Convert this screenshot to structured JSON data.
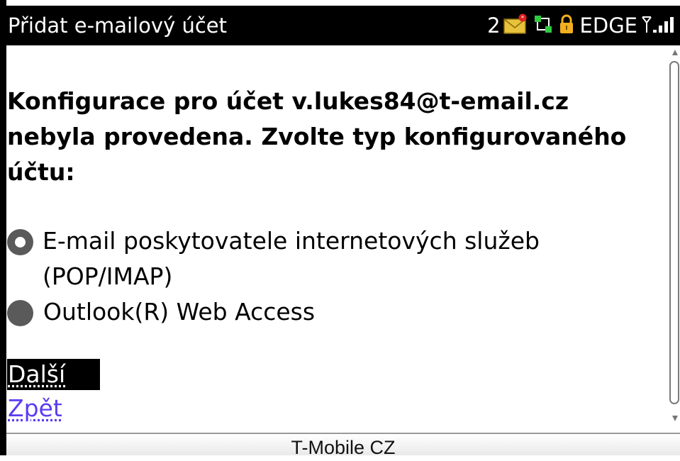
{
  "window": {
    "title": "Přidat e-mailový účet"
  },
  "status_bar": {
    "message_count": "2",
    "network": "EDGE",
    "icons": [
      "new-mail-icon",
      "data-transfer-icon",
      "lock-icon",
      "antenna-icon",
      "signal-bars-icon"
    ],
    "colors": {
      "mail_icon": "#e8c23a",
      "transfer_icon": "#2ecc40",
      "lock_icon": "#f2b01e"
    }
  },
  "main": {
    "heading": "Konfigurace pro účet v.lukes84@t-email.cz nebyla provedena. Zvolte typ konfigurovaného účtu:",
    "options": [
      {
        "label": "E-mail poskytovatele internetových služeb (POP/IMAP)",
        "selected": true
      },
      {
        "label": "Outlook(R) Web Access",
        "selected": false
      }
    ],
    "next_button": "Další",
    "back_link": "Zpět"
  },
  "footer": {
    "carrier": "T-Mobile CZ"
  },
  "colors": {
    "title_bar": "#000000",
    "link": "#5b3cf0",
    "radio": "#5a5a5a"
  }
}
